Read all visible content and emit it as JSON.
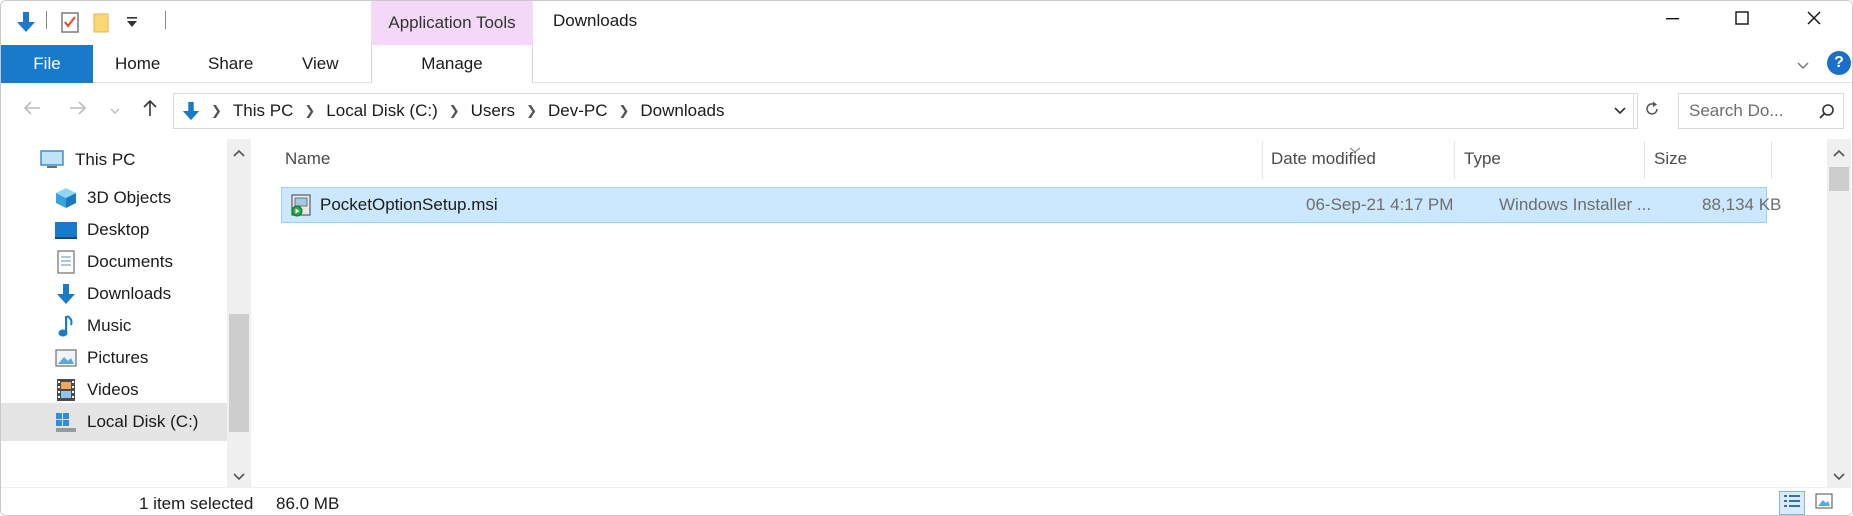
{
  "titlebar": {
    "context_tab_label": "Application Tools",
    "window_title": "Downloads"
  },
  "ribbon": {
    "file_label": "File",
    "tabs": [
      "Home",
      "Share",
      "View"
    ],
    "manage_label": "Manage"
  },
  "address": {
    "crumbs": [
      "This PC",
      "Local Disk (C:)",
      "Users",
      "Dev-PC",
      "Downloads"
    ],
    "search_placeholder": "Search Do..."
  },
  "nav_pane": {
    "root": "This PC",
    "items": [
      "3D Objects",
      "Desktop",
      "Documents",
      "Downloads",
      "Music",
      "Pictures",
      "Videos",
      "Local Disk (C:)"
    ]
  },
  "file_list": {
    "columns": [
      "Name",
      "Date modified",
      "Type",
      "Size"
    ],
    "rows": [
      {
        "name": "PocketOptionSetup.msi",
        "date_modified": "06-Sep-21 4:17 PM",
        "type": "Windows Installer ...",
        "size": "88,134 KB"
      }
    ]
  },
  "status": {
    "selection": "1 item selected",
    "size": "86.0 MB"
  },
  "colors": {
    "accent": "#1979ca",
    "selection_fill": "#cce8ff",
    "selection_border": "#99d1ff",
    "context_tab": "#f3d9f7"
  }
}
